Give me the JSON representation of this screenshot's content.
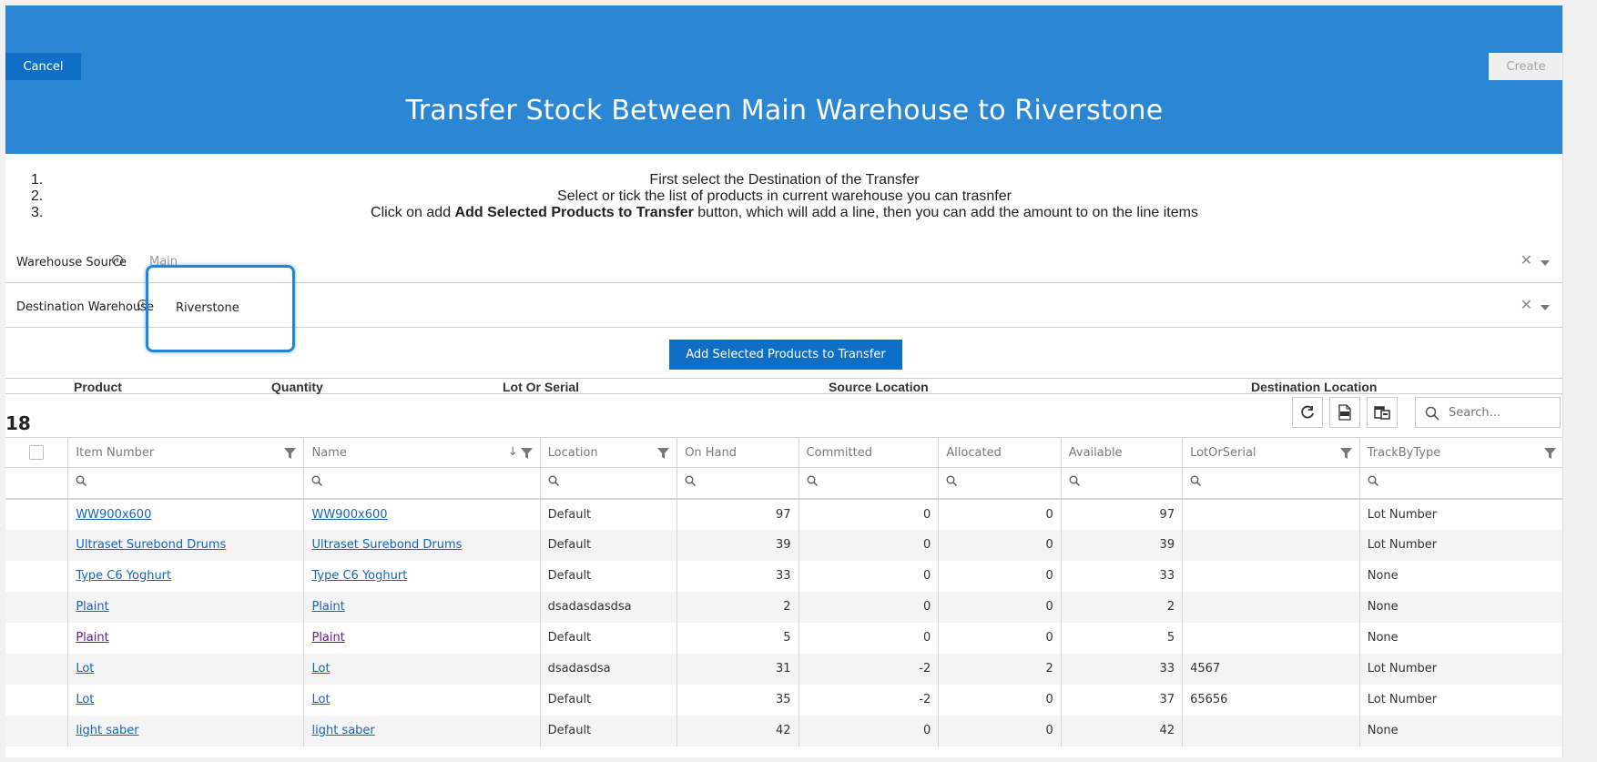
{
  "header": {
    "cancel_label": "Cancel",
    "create_label": "Create",
    "title": "Transfer Stock Between Main Warehouse to Riverstone",
    "background_color": "#2b87d3"
  },
  "instructions": [
    {
      "num": "1.",
      "text_before": "First select the Destination of the Transfer",
      "bold": "",
      "text_after": ""
    },
    {
      "num": "2.",
      "text_before": "Select or tick the list of products in current warehouse you can trasnfer",
      "bold": "",
      "text_after": ""
    },
    {
      "num": "3.",
      "text_before": "Click on add ",
      "bold": "Add Selected Products to Transfer",
      "text_after": " button, which will add a line, then you can add the amount to on the line items"
    }
  ],
  "form": {
    "source": {
      "label": "Warehouse Source",
      "value": "Main"
    },
    "destination": {
      "label": "Destination Warehouse",
      "value": "Riverstone"
    }
  },
  "add_button_label": "Add Selected Products to Transfer",
  "transfer_columns": [
    "Product",
    "Quantity",
    "Lot Or Serial",
    "Source Location",
    "Destination Location"
  ],
  "grid": {
    "count": "18",
    "search_placeholder": "Search...",
    "columns": [
      "Item Number",
      "Name",
      "Location",
      "On Hand",
      "Committed",
      "Allocated",
      "Available",
      "LotOrSerial",
      "TrackByType"
    ],
    "rows": [
      {
        "item": "WW900x600",
        "name": "WW900x600",
        "location": "Default",
        "on_hand": "97",
        "committed": "0",
        "allocated": "0",
        "available": "97",
        "lot": "",
        "track": "Lot Number"
      },
      {
        "item": "Ultraset Surebond Drums",
        "name": "Ultraset Surebond Drums",
        "location": "Default",
        "on_hand": "39",
        "committed": "0",
        "allocated": "0",
        "available": "39",
        "lot": "",
        "track": "Lot Number"
      },
      {
        "item": "Type C6 Yoghurt",
        "name": "Type C6 Yoghurt",
        "location": "Default",
        "on_hand": "33",
        "committed": "0",
        "allocated": "0",
        "available": "33",
        "lot": "",
        "track": "None"
      },
      {
        "item": "Plaint",
        "name": "Plaint",
        "location": "dsadasdasdsa",
        "on_hand": "2",
        "committed": "0",
        "allocated": "0",
        "available": "2",
        "lot": "",
        "track": "None"
      },
      {
        "item": "Plaint",
        "name": "Plaint",
        "location": "Default",
        "on_hand": "5",
        "committed": "0",
        "allocated": "0",
        "available": "5",
        "lot": "",
        "track": "None"
      },
      {
        "item": "Lot",
        "name": "Lot",
        "location": "dsadasdsa",
        "on_hand": "31",
        "committed": "-2",
        "allocated": "2",
        "available": "33",
        "lot": "4567",
        "track": "Lot Number"
      },
      {
        "item": "Lot",
        "name": "Lot",
        "location": "Default",
        "on_hand": "35",
        "committed": "-2",
        "allocated": "0",
        "available": "37",
        "lot": "65656",
        "track": "Lot Number"
      },
      {
        "item": "light saber",
        "name": "light saber",
        "location": "Default",
        "on_hand": "42",
        "committed": "0",
        "allocated": "0",
        "available": "42",
        "lot": "",
        "track": "None"
      }
    ]
  }
}
